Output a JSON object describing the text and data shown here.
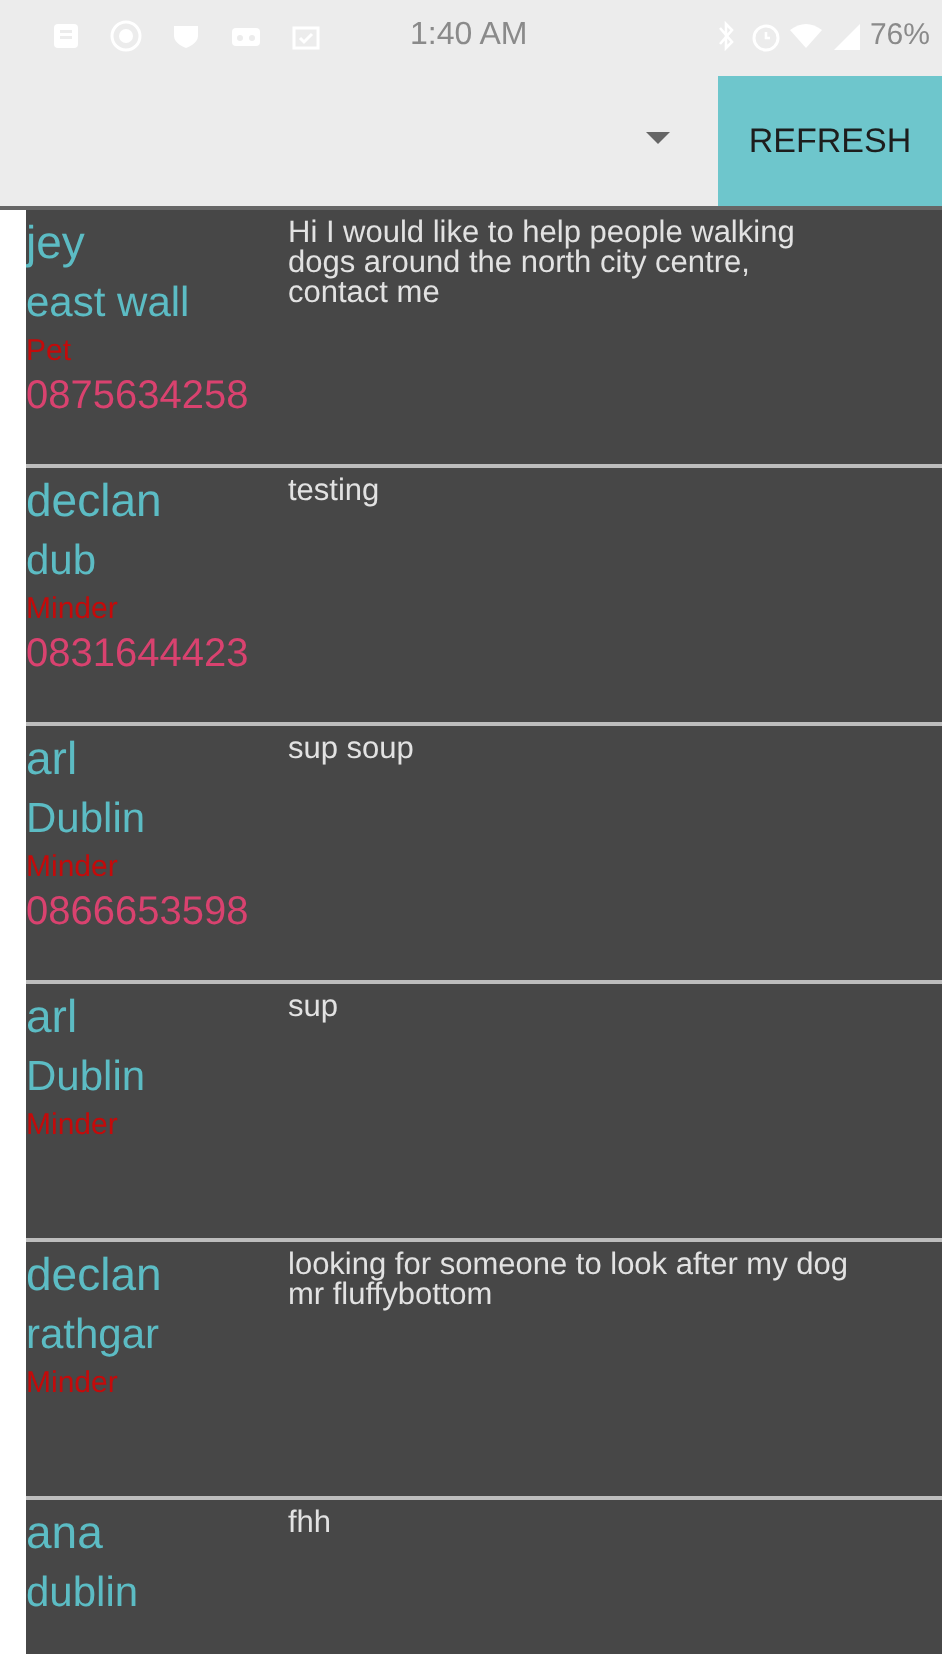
{
  "status_bar": {
    "time": "1:40 AM",
    "battery": "76%"
  },
  "toolbar": {
    "refresh_button": "REFRESH"
  },
  "posts": [
    {
      "name": "jey",
      "location": "east wall",
      "type": "Pet",
      "phone": "0875634258",
      "message": "Hi I would like to help people walking dogs around the north city centre, contact me"
    },
    {
      "name": "declan",
      "location": "dub",
      "type": "Minder",
      "phone": "0831644423",
      "message": "testing"
    },
    {
      "name": "arl",
      "location": "Dublin",
      "type": "Minder",
      "phone": "0866653598",
      "message": "sup soup"
    },
    {
      "name": "arl",
      "location": "Dublin",
      "type": "Minder",
      "message": "sup"
    },
    {
      "name": "declan",
      "location": "rathgar",
      "type": "Minder",
      "message": "looking for someone to look after my dog mr fluffybottom"
    },
    {
      "name": "ana",
      "location": "dublin",
      "message": "fhh"
    }
  ]
}
